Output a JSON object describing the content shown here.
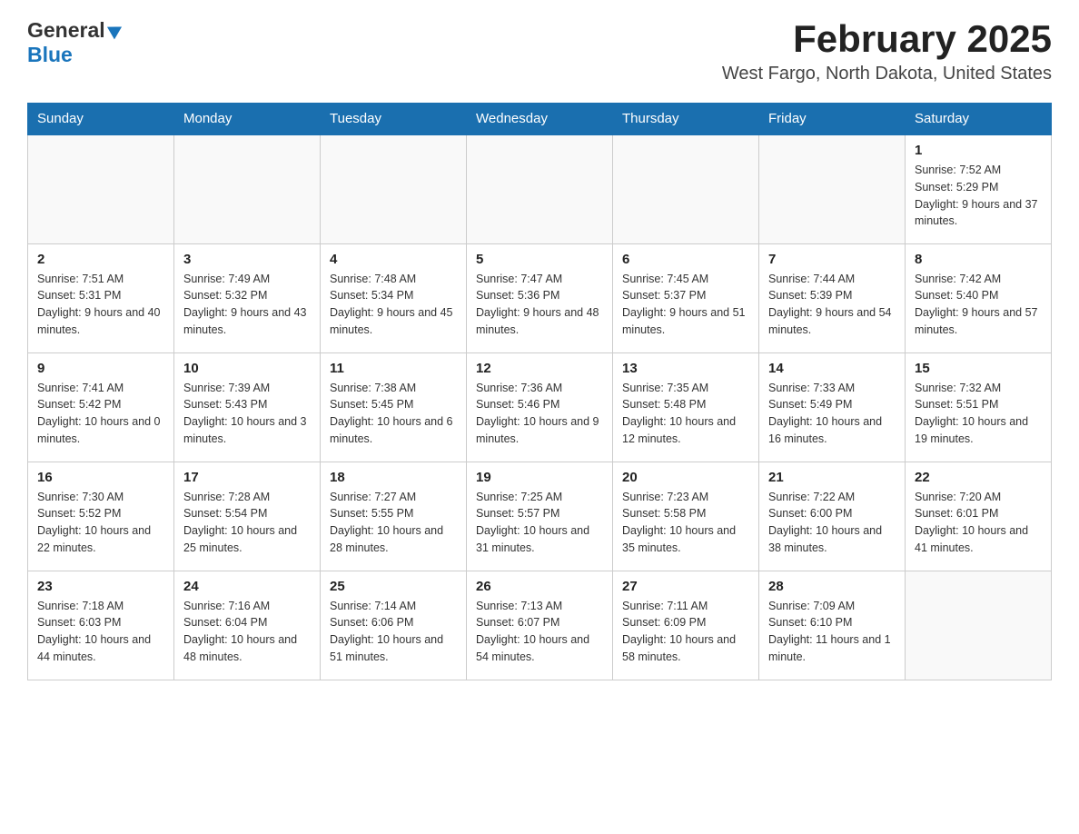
{
  "header": {
    "logo_general": "General",
    "logo_blue": "Blue",
    "title": "February 2025",
    "subtitle": "West Fargo, North Dakota, United States"
  },
  "days_of_week": [
    "Sunday",
    "Monday",
    "Tuesday",
    "Wednesday",
    "Thursday",
    "Friday",
    "Saturday"
  ],
  "weeks": [
    {
      "days": [
        {
          "number": "",
          "info": ""
        },
        {
          "number": "",
          "info": ""
        },
        {
          "number": "",
          "info": ""
        },
        {
          "number": "",
          "info": ""
        },
        {
          "number": "",
          "info": ""
        },
        {
          "number": "",
          "info": ""
        },
        {
          "number": "1",
          "info": "Sunrise: 7:52 AM\nSunset: 5:29 PM\nDaylight: 9 hours and 37 minutes."
        }
      ]
    },
    {
      "days": [
        {
          "number": "2",
          "info": "Sunrise: 7:51 AM\nSunset: 5:31 PM\nDaylight: 9 hours and 40 minutes."
        },
        {
          "number": "3",
          "info": "Sunrise: 7:49 AM\nSunset: 5:32 PM\nDaylight: 9 hours and 43 minutes."
        },
        {
          "number": "4",
          "info": "Sunrise: 7:48 AM\nSunset: 5:34 PM\nDaylight: 9 hours and 45 minutes."
        },
        {
          "number": "5",
          "info": "Sunrise: 7:47 AM\nSunset: 5:36 PM\nDaylight: 9 hours and 48 minutes."
        },
        {
          "number": "6",
          "info": "Sunrise: 7:45 AM\nSunset: 5:37 PM\nDaylight: 9 hours and 51 minutes."
        },
        {
          "number": "7",
          "info": "Sunrise: 7:44 AM\nSunset: 5:39 PM\nDaylight: 9 hours and 54 minutes."
        },
        {
          "number": "8",
          "info": "Sunrise: 7:42 AM\nSunset: 5:40 PM\nDaylight: 9 hours and 57 minutes."
        }
      ]
    },
    {
      "days": [
        {
          "number": "9",
          "info": "Sunrise: 7:41 AM\nSunset: 5:42 PM\nDaylight: 10 hours and 0 minutes."
        },
        {
          "number": "10",
          "info": "Sunrise: 7:39 AM\nSunset: 5:43 PM\nDaylight: 10 hours and 3 minutes."
        },
        {
          "number": "11",
          "info": "Sunrise: 7:38 AM\nSunset: 5:45 PM\nDaylight: 10 hours and 6 minutes."
        },
        {
          "number": "12",
          "info": "Sunrise: 7:36 AM\nSunset: 5:46 PM\nDaylight: 10 hours and 9 minutes."
        },
        {
          "number": "13",
          "info": "Sunrise: 7:35 AM\nSunset: 5:48 PM\nDaylight: 10 hours and 12 minutes."
        },
        {
          "number": "14",
          "info": "Sunrise: 7:33 AM\nSunset: 5:49 PM\nDaylight: 10 hours and 16 minutes."
        },
        {
          "number": "15",
          "info": "Sunrise: 7:32 AM\nSunset: 5:51 PM\nDaylight: 10 hours and 19 minutes."
        }
      ]
    },
    {
      "days": [
        {
          "number": "16",
          "info": "Sunrise: 7:30 AM\nSunset: 5:52 PM\nDaylight: 10 hours and 22 minutes."
        },
        {
          "number": "17",
          "info": "Sunrise: 7:28 AM\nSunset: 5:54 PM\nDaylight: 10 hours and 25 minutes."
        },
        {
          "number": "18",
          "info": "Sunrise: 7:27 AM\nSunset: 5:55 PM\nDaylight: 10 hours and 28 minutes."
        },
        {
          "number": "19",
          "info": "Sunrise: 7:25 AM\nSunset: 5:57 PM\nDaylight: 10 hours and 31 minutes."
        },
        {
          "number": "20",
          "info": "Sunrise: 7:23 AM\nSunset: 5:58 PM\nDaylight: 10 hours and 35 minutes."
        },
        {
          "number": "21",
          "info": "Sunrise: 7:22 AM\nSunset: 6:00 PM\nDaylight: 10 hours and 38 minutes."
        },
        {
          "number": "22",
          "info": "Sunrise: 7:20 AM\nSunset: 6:01 PM\nDaylight: 10 hours and 41 minutes."
        }
      ]
    },
    {
      "days": [
        {
          "number": "23",
          "info": "Sunrise: 7:18 AM\nSunset: 6:03 PM\nDaylight: 10 hours and 44 minutes."
        },
        {
          "number": "24",
          "info": "Sunrise: 7:16 AM\nSunset: 6:04 PM\nDaylight: 10 hours and 48 minutes."
        },
        {
          "number": "25",
          "info": "Sunrise: 7:14 AM\nSunset: 6:06 PM\nDaylight: 10 hours and 51 minutes."
        },
        {
          "number": "26",
          "info": "Sunrise: 7:13 AM\nSunset: 6:07 PM\nDaylight: 10 hours and 54 minutes."
        },
        {
          "number": "27",
          "info": "Sunrise: 7:11 AM\nSunset: 6:09 PM\nDaylight: 10 hours and 58 minutes."
        },
        {
          "number": "28",
          "info": "Sunrise: 7:09 AM\nSunset: 6:10 PM\nDaylight: 11 hours and 1 minute."
        },
        {
          "number": "",
          "info": ""
        }
      ]
    }
  ]
}
